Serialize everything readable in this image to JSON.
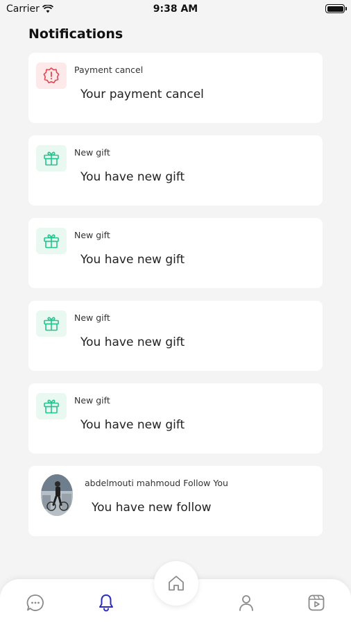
{
  "status_bar": {
    "carrier": "Carrier",
    "time": "9:38 AM"
  },
  "page_title": "Notifications",
  "notifications": [
    {
      "type": "warning",
      "icon": "alert-badge-icon",
      "title": "Payment cancel",
      "body": "Your payment cancel"
    },
    {
      "type": "gift",
      "icon": "gift-icon",
      "title": "New gift",
      "body": "You have new gift"
    },
    {
      "type": "gift",
      "icon": "gift-icon",
      "title": "New gift",
      "body": "You have new gift"
    },
    {
      "type": "gift",
      "icon": "gift-icon",
      "title": "New gift",
      "body": "You have new gift"
    },
    {
      "type": "gift",
      "icon": "gift-icon",
      "title": "New gift",
      "body": "You have new gift"
    },
    {
      "type": "follow",
      "icon": "avatar",
      "title": "abdelmouti mahmoud Follow You",
      "body": "You have new follow"
    }
  ],
  "bottom_nav": {
    "items": [
      {
        "name": "chat",
        "icon": "chat-icon",
        "active": false
      },
      {
        "name": "notifications",
        "icon": "bell-icon",
        "active": true
      },
      {
        "name": "home",
        "icon": "home-icon",
        "active": false
      },
      {
        "name": "profile",
        "icon": "person-icon",
        "active": false
      },
      {
        "name": "videos",
        "icon": "play-icon",
        "active": false
      }
    ]
  },
  "colors": {
    "background": "#f4f4f4",
    "card": "#ffffff",
    "warning": "#e0444f",
    "gift": "#22c38e",
    "active_nav": "#2b2bbd",
    "inactive_nav": "#8a8a8a"
  }
}
